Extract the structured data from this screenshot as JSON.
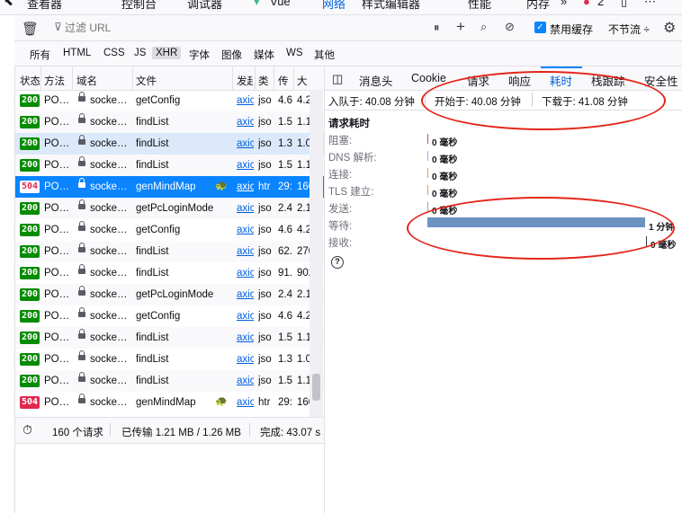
{
  "devtools_tabs": {
    "inspector": "查看器",
    "console": "控制台",
    "debugger": "调试器",
    "vue": "Vue",
    "network": "网络",
    "style_editor": "样式编辑器",
    "performance": "性能",
    "memory": "内存",
    "more": "»",
    "error_count": "2",
    "options": "⋯"
  },
  "toolbar": {
    "filter_placeholder": "过滤 URL",
    "disable_cache_label": "禁用缓存",
    "throttle_label": "不节流 ÷"
  },
  "filter_types": [
    "所有",
    "HTML",
    "CSS",
    "JS",
    "XHR",
    "字体",
    "图像",
    "媒体",
    "WS",
    "其他"
  ],
  "selected_filter": "XHR",
  "table_headers": {
    "status": "状态",
    "method": "方法",
    "domain": "域名",
    "file": "文件",
    "initiator": "发起",
    "type": "类",
    "transferred": "传",
    "size": "大"
  },
  "requests": [
    {
      "status": "200",
      "method": "PO…",
      "domain": "socke…",
      "file": "getConfig",
      "initiator": "axic",
      "type": "jso",
      "transferred": "4.6",
      "size": "4.2"
    },
    {
      "status": "200",
      "method": "PO…",
      "domain": "socke…",
      "file": "findList",
      "initiator": "axic",
      "type": "jso",
      "transferred": "1.5",
      "size": "1.1"
    },
    {
      "status": "200",
      "method": "PO…",
      "domain": "socke…",
      "file": "findList",
      "initiator": "axic",
      "type": "jso",
      "transferred": "1.3",
      "size": "1.0"
    },
    {
      "status": "200",
      "method": "PO…",
      "domain": "socke…",
      "file": "findList",
      "initiator": "axic",
      "type": "jso",
      "transferred": "1.5",
      "size": "1.1"
    },
    {
      "status": "504",
      "method": "PO…",
      "domain": "socke…",
      "file": "genMindMap",
      "initiator": "axic",
      "type": "htr",
      "transferred": "29:",
      "size": "160"
    },
    {
      "status": "200",
      "method": "PO…",
      "domain": "socke…",
      "file": "getPcLoginMode",
      "initiator": "axic",
      "type": "jso",
      "transferred": "2.4",
      "size": "2.1"
    },
    {
      "status": "200",
      "method": "PO…",
      "domain": "socke…",
      "file": "getConfig",
      "initiator": "axic",
      "type": "jso",
      "transferred": "4.6",
      "size": "4.2"
    },
    {
      "status": "200",
      "method": "PO…",
      "domain": "socke…",
      "file": "findList",
      "initiator": "axic",
      "type": "jso",
      "transferred": "62.",
      "size": "270"
    },
    {
      "status": "200",
      "method": "PO…",
      "domain": "socke…",
      "file": "findList",
      "initiator": "axic",
      "type": "jso",
      "transferred": "91.",
      "size": "902"
    },
    {
      "status": "200",
      "method": "PO…",
      "domain": "socke…",
      "file": "getPcLoginMode",
      "initiator": "axic",
      "type": "jso",
      "transferred": "2.4",
      "size": "2.1"
    },
    {
      "status": "200",
      "method": "PO…",
      "domain": "socke…",
      "file": "getConfig",
      "initiator": "axic",
      "type": "jso",
      "transferred": "4.6",
      "size": "4.2"
    },
    {
      "status": "200",
      "method": "PO…",
      "domain": "socke…",
      "file": "findList",
      "initiator": "axic",
      "type": "jso",
      "transferred": "1.5",
      "size": "1.1"
    },
    {
      "status": "200",
      "method": "PO…",
      "domain": "socke…",
      "file": "findList",
      "initiator": "axic",
      "type": "jso",
      "transferred": "1.3",
      "size": "1.0"
    },
    {
      "status": "200",
      "method": "PO…",
      "domain": "socke…",
      "file": "findList",
      "initiator": "axic",
      "type": "jso",
      "transferred": "1.5",
      "size": "1.1"
    },
    {
      "status": "504",
      "method": "PO…",
      "domain": "socke…",
      "file": "genMindMap",
      "initiator": "axic",
      "type": "htr",
      "transferred": "29:",
      "size": "160"
    }
  ],
  "statusbar": {
    "requests": "160 个请求",
    "transferred": "已传输 1.21 MB / 1.26 MB",
    "finish": "完成: 43.07 s"
  },
  "detail_tabs": [
    "消息头",
    "Cookie",
    "请求",
    "响应",
    "耗时",
    "栈跟踪",
    "安全性"
  ],
  "selected_detail_tab": "耗时",
  "timing_info": {
    "queued": "入队于: 40.08 分钟",
    "started": "开始于: 40.08 分钟",
    "downloaded": "下载于: 41.08 分钟"
  },
  "timings": {
    "title": "请求耗时",
    "rows": [
      {
        "label": "阻塞:",
        "value": "0 毫秒",
        "color": "#c34a80"
      },
      {
        "label": "DNS 解析:",
        "value": "0 毫秒",
        "color": "#c5a0dc"
      },
      {
        "label": "连接:",
        "value": "0 毫秒",
        "color": "#d6a266"
      },
      {
        "label": "TLS 建立:",
        "value": "0 毫秒",
        "color": "#d6a266"
      },
      {
        "label": "发送:",
        "value": "0 毫秒",
        "color": "#b9a272"
      },
      {
        "label": "等待:",
        "value": "1 分钟",
        "color": "#6d93c2"
      },
      {
        "label": "接收:",
        "value": "0 毫秒",
        "color": "#38383d"
      }
    ]
  },
  "help_glyph": "?"
}
